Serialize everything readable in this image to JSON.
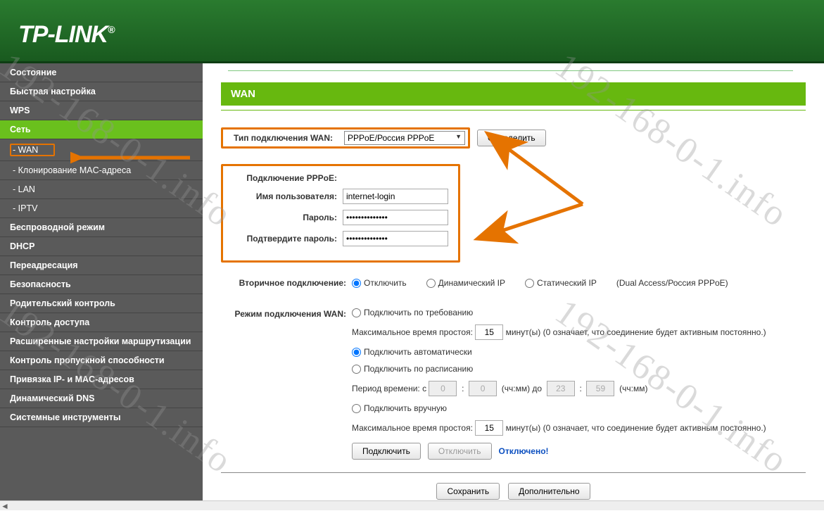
{
  "brand": {
    "logo": "TP-LINK",
    "trademark": "®"
  },
  "sidebar": {
    "items": [
      {
        "label": "Состояние",
        "type": "top"
      },
      {
        "label": "Быстрая настройка",
        "type": "top"
      },
      {
        "label": "WPS",
        "type": "top"
      },
      {
        "label": "Сеть",
        "type": "top",
        "active": true
      },
      {
        "label": "- WAN",
        "type": "sub",
        "current": true
      },
      {
        "label": "- Клонирование MAC-адреса",
        "type": "sub"
      },
      {
        "label": "- LAN",
        "type": "sub"
      },
      {
        "label": "- IPTV",
        "type": "sub"
      },
      {
        "label": "Беспроводной режим",
        "type": "top"
      },
      {
        "label": "DHCP",
        "type": "top"
      },
      {
        "label": "Переадресация",
        "type": "top"
      },
      {
        "label": "Безопасность",
        "type": "top"
      },
      {
        "label": "Родительский контроль",
        "type": "top"
      },
      {
        "label": "Контроль доступа",
        "type": "top"
      },
      {
        "label": "Расширенные настройки маршрутизации",
        "type": "top"
      },
      {
        "label": "Контроль пропускной способности",
        "type": "top"
      },
      {
        "label": "Привязка IP- и MAC-адресов",
        "type": "top"
      },
      {
        "label": "Динамический DNS",
        "type": "top"
      },
      {
        "label": "Системные инструменты",
        "type": "top"
      }
    ]
  },
  "page": {
    "title": "WAN",
    "wan_type": {
      "label": "Тип подключения WAN:",
      "selected": "PPPoE/Россия PPPoE",
      "detect_btn": "Определить"
    },
    "pppoe": {
      "heading": "Подключение PPPoE:",
      "user_label": "Имя пользователя:",
      "user_value": "internet-login",
      "pass_label": "Пароль:",
      "pass_value": "••••••••••••••",
      "confirm_label": "Подтвердите пароль:",
      "confirm_value": "••••••••••••••"
    },
    "secondary": {
      "label": "Вторичное подключение:",
      "opt_off": "Отключить",
      "opt_dyn": "Динамический IP",
      "opt_static": "Статический IP",
      "suffix": "(Dual Access/Россия PPPoE)"
    },
    "mode": {
      "label": "Режим подключения WAN:",
      "opt_demand": "Подключить по требованию",
      "idle_label": "Максимальное время простоя:",
      "idle_value": "15",
      "idle_suffix": "минут(ы) (0 означает, что соединение будет активным постоянно.)",
      "opt_auto": "Подключить автоматически",
      "opt_sched": "Подключить по расписанию",
      "period_label": "Период времени:  с",
      "period_from_h": "0",
      "period_from_m": "0",
      "hhmm1": "(чч:мм) до",
      "period_to_h": "23",
      "period_to_m": "59",
      "hhmm2": "(чч:мм)",
      "opt_manual": "Подключить вручную",
      "idle2_value": "15",
      "connect_btn": "Подключить",
      "disconnect_btn": "Отключить",
      "status": "Отключено!"
    },
    "actions": {
      "save": "Сохранить",
      "advanced": "Дополнительно"
    }
  },
  "watermark": "192-168-0-1.info"
}
